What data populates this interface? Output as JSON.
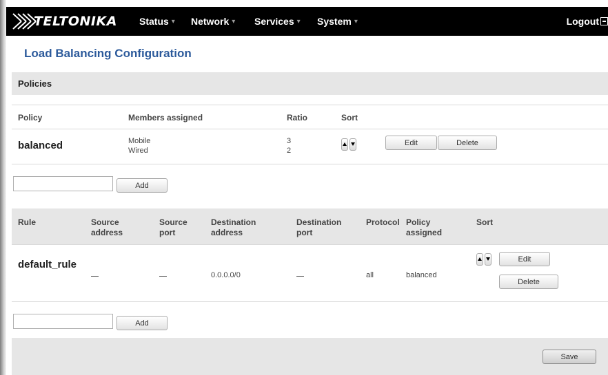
{
  "brand": {
    "name": "TELTONIKA"
  },
  "nav": {
    "items": [
      {
        "label": "Status"
      },
      {
        "label": "Network"
      },
      {
        "label": "Services"
      },
      {
        "label": "System"
      }
    ],
    "logout_label": "Logout"
  },
  "page": {
    "title": "Load Balancing Configuration"
  },
  "policies": {
    "section_title": "Policies",
    "columns": {
      "policy": "Policy",
      "members": "Members assigned",
      "ratio": "Ratio",
      "sort": "Sort"
    },
    "rows": [
      {
        "name": "balanced",
        "members": [
          "Mobile",
          "Wired"
        ],
        "ratios": [
          "3",
          "2"
        ],
        "edit_label": "Edit",
        "delete_label": "Delete"
      }
    ],
    "new_name_value": "",
    "add_label": "Add"
  },
  "rules": {
    "columns": {
      "rule": "Rule",
      "src_addr_1": "Source",
      "src_addr_2": "address",
      "src_port_1": "Source",
      "src_port_2": "port",
      "dst_addr_1": "Destination",
      "dst_addr_2": "address",
      "dst_port_1": "Destination",
      "dst_port_2": "port",
      "protocol": "Protocol",
      "policy_1": "Policy",
      "policy_2": "assigned",
      "sort": "Sort"
    },
    "rows": [
      {
        "name": "default_rule",
        "dest_address": "0.0.0.0/0",
        "protocol": "all",
        "policy": "balanced",
        "edit_label": "Edit",
        "delete_label": "Delete"
      }
    ],
    "new_name_value": "",
    "add_label": "Add"
  },
  "footer": {
    "save_label": "Save"
  },
  "colors": {
    "topbar": "#000000",
    "title": "#2c5a9b",
    "section_bar": "#e6e6e6"
  }
}
